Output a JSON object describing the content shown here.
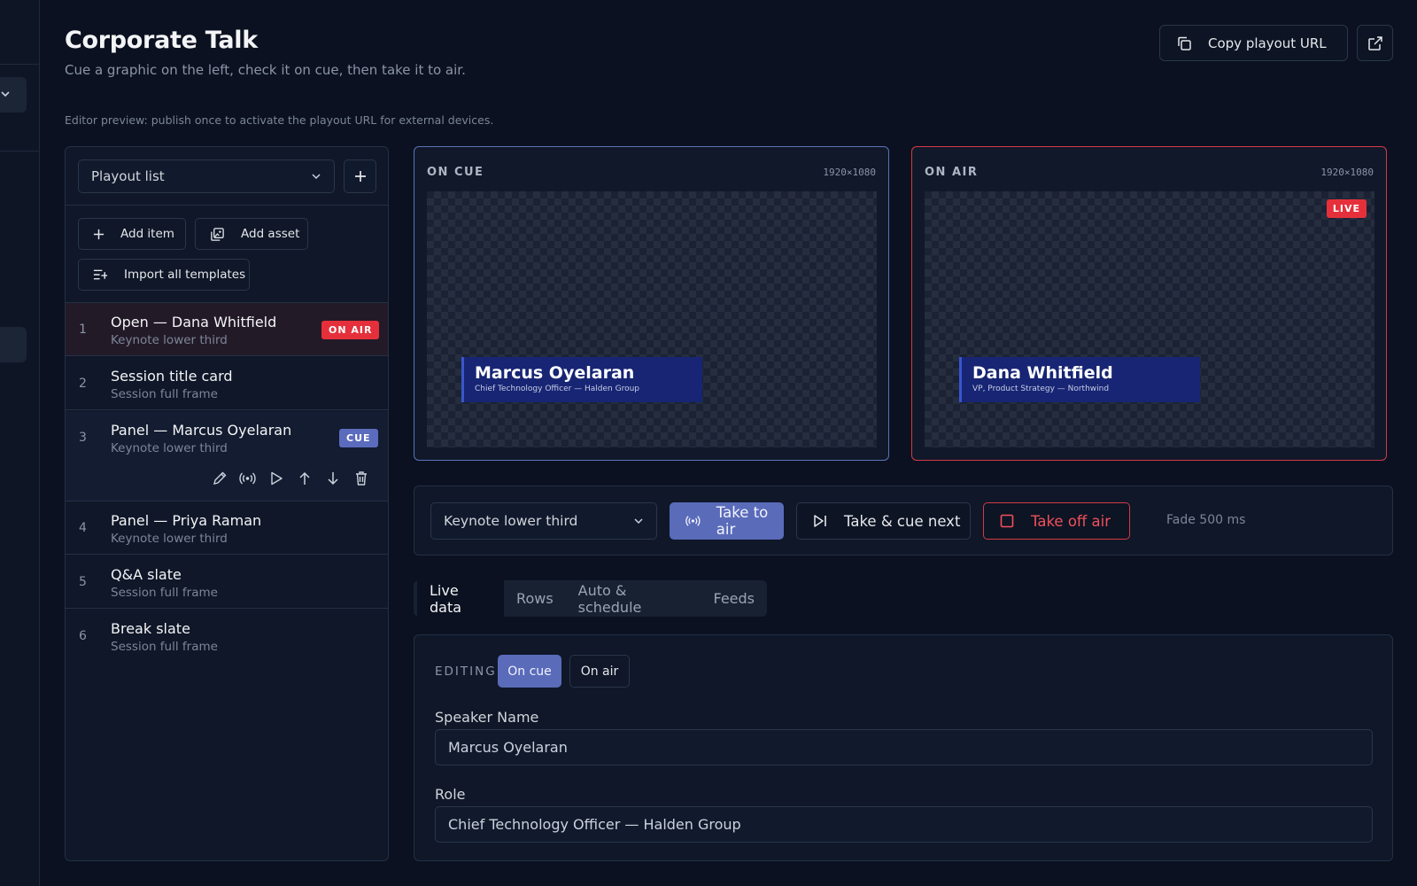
{
  "header": {
    "title": "Corporate Talk",
    "subtitle": "Cue a graphic on the left, check it on cue, then take it to air.",
    "copy_label": "Copy playout URL"
  },
  "editor_note": "Editor preview: publish once to activate the playout URL for external devices.",
  "playout": {
    "list_select": "Playout list",
    "add_item": "Add item",
    "add_asset": "Add asset",
    "import_templates": "Import all templates",
    "items": [
      {
        "num": "1",
        "name": "Open — Dana Whitfield",
        "template": "Keynote lower third",
        "badge": "ON AIR"
      },
      {
        "num": "2",
        "name": "Session title card",
        "template": "Session full frame"
      },
      {
        "num": "3",
        "name": "Panel — Marcus Oyelaran",
        "template": "Keynote lower third",
        "badge": "CUE"
      },
      {
        "num": "4",
        "name": "Panel — Priya Raman",
        "template": "Keynote lower third"
      },
      {
        "num": "5",
        "name": "Q&A slate",
        "template": "Session full frame"
      },
      {
        "num": "6",
        "name": "Break slate",
        "template": "Session full frame"
      }
    ]
  },
  "monitors": {
    "cue": {
      "label": "ON CUE",
      "resolution": "1920×1080",
      "name": "Marcus Oyelaran",
      "role": "Chief Technology Officer — Halden Group"
    },
    "air": {
      "label": "ON AIR",
      "resolution": "1920×1080",
      "name": "Dana Whitfield",
      "role": "VP, Product Strategy — Northwind",
      "live": "LIVE"
    }
  },
  "transport": {
    "template_select": "Keynote lower third",
    "take": "Take to air",
    "take_next": "Take & cue next",
    "take_off": "Take off air",
    "fade": "Fade 500 ms"
  },
  "tabs": [
    "Live data",
    "Rows",
    "Auto & schedule",
    "Feeds"
  ],
  "editor": {
    "label": "EDITING",
    "on_cue": "On cue",
    "on_air": "On air",
    "fields": [
      {
        "label": "Speaker Name",
        "value": "Marcus Oyelaran"
      },
      {
        "label": "Role",
        "value": "Chief Technology Officer — Halden Group"
      }
    ]
  },
  "colors": {
    "accent": "#5a6bba",
    "live": "#e5303b",
    "background": "#0b1120",
    "lower_third": "#172574"
  }
}
